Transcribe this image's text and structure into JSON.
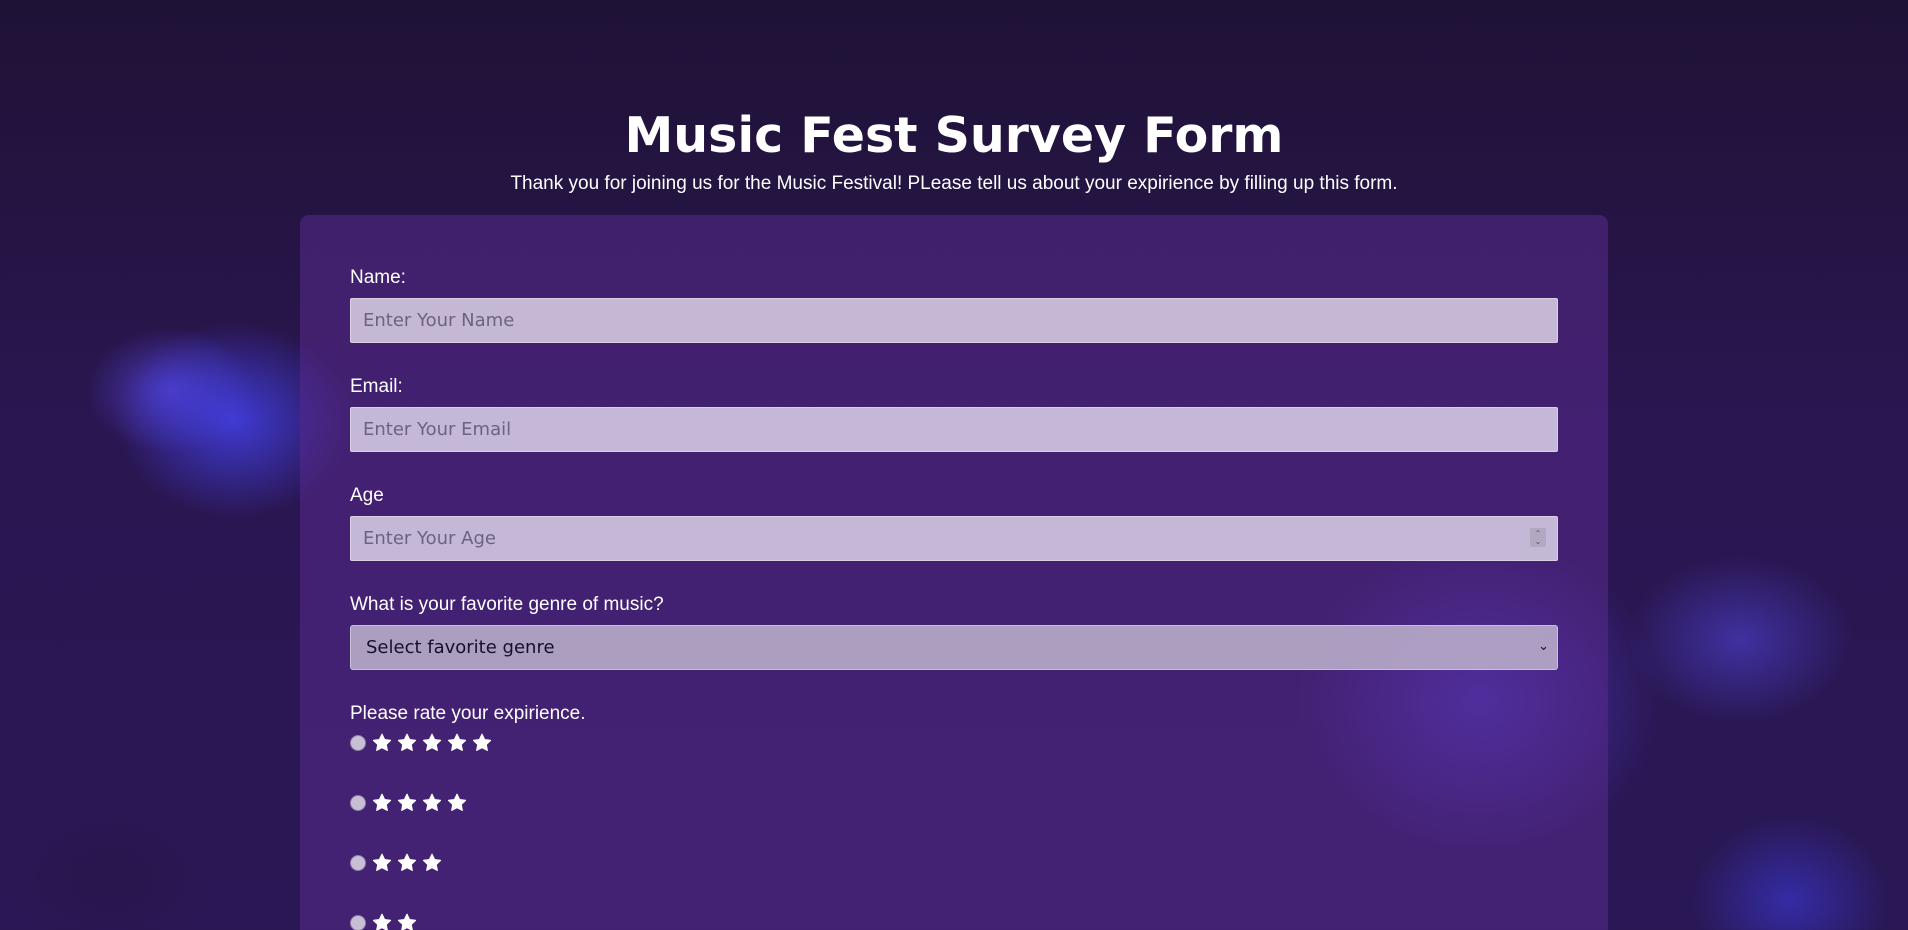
{
  "header": {
    "title": "Music Fest Survey Form",
    "subtitle": "Thank you for joining us for the Music Festival! PLease tell us about your expirience by filling up this form."
  },
  "form": {
    "name": {
      "label": "Name:",
      "placeholder": "Enter Your Name"
    },
    "email": {
      "label": "Email:",
      "placeholder": "Enter Your Email"
    },
    "age": {
      "label": "Age",
      "placeholder": "Enter Your Age"
    },
    "genre": {
      "label": "What is your favorite genre of music?",
      "selected": "Select favorite genre"
    },
    "rating": {
      "label": "Please rate your expirience.",
      "options": [
        {
          "stars": 5
        },
        {
          "stars": 4
        },
        {
          "stars": 3
        },
        {
          "stars": 2
        }
      ]
    }
  },
  "icons": {
    "star": "star-icon",
    "spinner": "number-spinner-icon",
    "dropdown": "chevron-down-icon"
  },
  "colors": {
    "background": "#22123d",
    "card": "#582a8c",
    "text": "#ffffff",
    "input_fill": "#d7cde4"
  }
}
